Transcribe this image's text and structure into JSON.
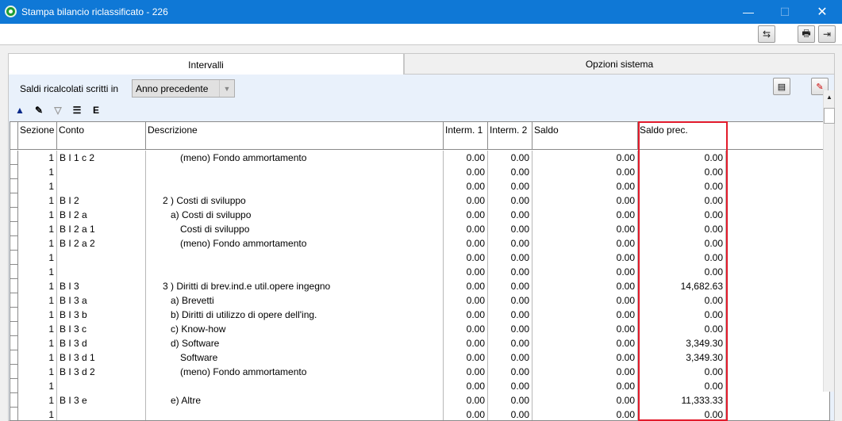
{
  "window": {
    "title": "Stampa bilancio riclassificato - 226"
  },
  "tabs": [
    {
      "label": "Intervalli"
    },
    {
      "label": "Opzioni sistema"
    }
  ],
  "saldi": {
    "label": "Saldi ricalcolati scritti in",
    "value": "Anno precedente"
  },
  "columns": {
    "sezione": "Sezione",
    "conto": "Conto",
    "descrizione": "Descrizione",
    "interm1": "Interm. 1",
    "interm2": "Interm. 2",
    "saldo": "Saldo",
    "saldo_prec": "Saldo prec."
  },
  "rows": [
    {
      "sezione": "1",
      "conto": "B I 1 c 2",
      "descrizione": "(meno) Fondo ammortamento",
      "indent": 3,
      "interm1": "0.00",
      "interm2": "0.00",
      "saldo": "0.00",
      "saldo_prec": "0.00"
    },
    {
      "sezione": "1",
      "conto": "",
      "descrizione": "",
      "indent": 0,
      "interm1": "0.00",
      "interm2": "0.00",
      "saldo": "0.00",
      "saldo_prec": "0.00"
    },
    {
      "sezione": "1",
      "conto": "",
      "descrizione": "",
      "indent": 0,
      "interm1": "0.00",
      "interm2": "0.00",
      "saldo": "0.00",
      "saldo_prec": "0.00"
    },
    {
      "sezione": "1",
      "conto": "B I 2",
      "descrizione": "2 ) Costi di sviluppo",
      "indent": 1,
      "interm1": "0.00",
      "interm2": "0.00",
      "saldo": "0.00",
      "saldo_prec": "0.00"
    },
    {
      "sezione": "1",
      "conto": "B I 2 a",
      "descrizione": "a) Costi di sviluppo",
      "indent": 2,
      "interm1": "0.00",
      "interm2": "0.00",
      "saldo": "0.00",
      "saldo_prec": "0.00"
    },
    {
      "sezione": "1",
      "conto": "B I 2 a 1",
      "descrizione": "Costi di sviluppo",
      "indent": 3,
      "interm1": "0.00",
      "interm2": "0.00",
      "saldo": "0.00",
      "saldo_prec": "0.00"
    },
    {
      "sezione": "1",
      "conto": "B I 2 a 2",
      "descrizione": "(meno) Fondo ammortamento",
      "indent": 3,
      "interm1": "0.00",
      "interm2": "0.00",
      "saldo": "0.00",
      "saldo_prec": "0.00"
    },
    {
      "sezione": "1",
      "conto": "",
      "descrizione": "",
      "indent": 0,
      "interm1": "0.00",
      "interm2": "0.00",
      "saldo": "0.00",
      "saldo_prec": "0.00"
    },
    {
      "sezione": "1",
      "conto": "",
      "descrizione": "",
      "indent": 0,
      "interm1": "0.00",
      "interm2": "0.00",
      "saldo": "0.00",
      "saldo_prec": "0.00"
    },
    {
      "sezione": "1",
      "conto": "B I 3",
      "descrizione": "3 ) Diritti di brev.ind.e util.opere ingegno",
      "indent": 1,
      "interm1": "0.00",
      "interm2": "0.00",
      "saldo": "0.00",
      "saldo_prec": "14,682.63"
    },
    {
      "sezione": "1",
      "conto": "B I 3 a",
      "descrizione": "a) Brevetti",
      "indent": 2,
      "interm1": "0.00",
      "interm2": "0.00",
      "saldo": "0.00",
      "saldo_prec": "0.00"
    },
    {
      "sezione": "1",
      "conto": "B I 3 b",
      "descrizione": "b) Diritti di utilizzo di opere dell'ing.",
      "indent": 2,
      "interm1": "0.00",
      "interm2": "0.00",
      "saldo": "0.00",
      "saldo_prec": "0.00"
    },
    {
      "sezione": "1",
      "conto": "B I 3 c",
      "descrizione": "c) Know-how",
      "indent": 2,
      "interm1": "0.00",
      "interm2": "0.00",
      "saldo": "0.00",
      "saldo_prec": "0.00"
    },
    {
      "sezione": "1",
      "conto": "B I 3 d",
      "descrizione": "d) Software",
      "indent": 2,
      "interm1": "0.00",
      "interm2": "0.00",
      "saldo": "0.00",
      "saldo_prec": "3,349.30"
    },
    {
      "sezione": "1",
      "conto": "B I 3 d 1",
      "descrizione": "Software",
      "indent": 3,
      "interm1": "0.00",
      "interm2": "0.00",
      "saldo": "0.00",
      "saldo_prec": "3,349.30"
    },
    {
      "sezione": "1",
      "conto": "B I 3 d 2",
      "descrizione": "(meno) Fondo ammortamento",
      "indent": 3,
      "interm1": "0.00",
      "interm2": "0.00",
      "saldo": "0.00",
      "saldo_prec": "0.00"
    },
    {
      "sezione": "1",
      "conto": "",
      "descrizione": "",
      "indent": 0,
      "interm1": "0.00",
      "interm2": "0.00",
      "saldo": "0.00",
      "saldo_prec": "0.00"
    },
    {
      "sezione": "1",
      "conto": "B I 3 e",
      "descrizione": "e) Altre",
      "indent": 2,
      "interm1": "0.00",
      "interm2": "0.00",
      "saldo": "0.00",
      "saldo_prec": "11,333.33"
    },
    {
      "sezione": "1",
      "conto": "",
      "descrizione": "",
      "indent": 0,
      "interm1": "0.00",
      "interm2": "0.00",
      "saldo": "0.00",
      "saldo_prec": "0.00"
    }
  ],
  "colors": {
    "titlebar": "#0f78d6",
    "highlight": "#e21b2b",
    "panel": "#e9f1fb"
  },
  "icons": {
    "titlebar": [
      "app-icon",
      "minimize-icon",
      "maximize-icon",
      "close-icon"
    ],
    "toolbar": [
      "refresh-arrows-icon",
      "print-icon",
      "exit-door-icon"
    ],
    "panel": [
      "report-icon",
      "edit-erase-icon"
    ],
    "grid_tools": [
      "move-up-icon",
      "edit-list-icon",
      "filter-icon",
      "column-layout-icon",
      "export-excel-icon"
    ]
  }
}
